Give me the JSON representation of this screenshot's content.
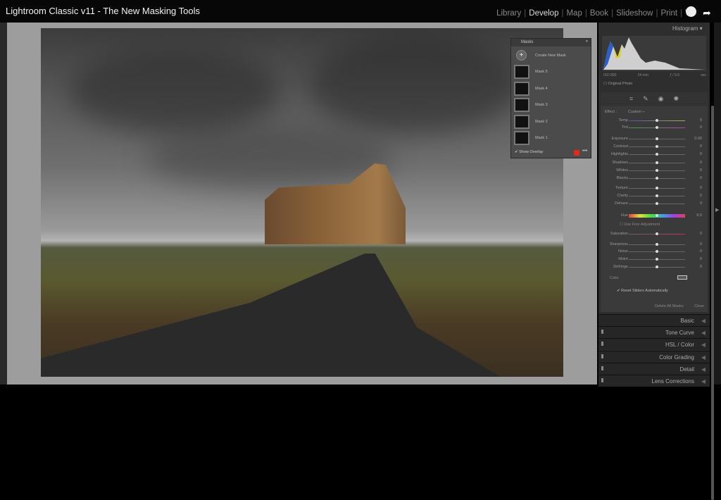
{
  "title": "Lightroom Classic v11 - The New Masking Tools",
  "modules": [
    {
      "label": "Library"
    },
    {
      "label": "Develop",
      "active": true
    },
    {
      "label": "Map"
    },
    {
      "label": "Book"
    },
    {
      "label": "Slideshow"
    },
    {
      "label": "Print"
    },
    {
      "label": "W"
    }
  ],
  "masks_panel": {
    "title": "Masks",
    "create": "Create New Mask",
    "masks": [
      "Mask 5",
      "Mask 4",
      "Mask 3",
      "Mask 2",
      "Mask 1"
    ],
    "show_overlay": "Show Overlay",
    "overlay_color": "#e02a1a"
  },
  "histogram": {
    "title": "Histogram",
    "iso": "ISO 800",
    "focal": "24 mm",
    "aperture": "ƒ / 9.0",
    "shutter": "sec",
    "original_photo": "Original Photo"
  },
  "mask_edit": {
    "effect_label": "Effect :",
    "effect_value": "Custom ÷",
    "sliders": [
      {
        "label": "Temp",
        "value": "0"
      },
      {
        "label": "Tint",
        "value": "0"
      },
      {
        "label": "Exposure",
        "value": "0.00"
      },
      {
        "label": "Contrast",
        "value": "0"
      },
      {
        "label": "Highlights",
        "value": "0"
      },
      {
        "label": "Shadows",
        "value": "0"
      },
      {
        "label": "Whites",
        "value": "0"
      },
      {
        "label": "Blacks",
        "value": "0"
      },
      {
        "label": "Texture",
        "value": "0"
      },
      {
        "label": "Clarity",
        "value": "0"
      },
      {
        "label": "Dehaze",
        "value": "0"
      },
      {
        "label": "Hue",
        "value": "0.0"
      },
      {
        "label": "Saturation",
        "value": "0"
      },
      {
        "label": "Sharpness",
        "value": "0"
      },
      {
        "label": "Noise",
        "value": "0"
      },
      {
        "label": "Moiré",
        "value": "0"
      },
      {
        "label": "Defringe",
        "value": "0"
      }
    ],
    "fine_adjustment": "Use Fine Adjustment",
    "color_label": "Color",
    "reset_sliders": "Reset Sliders Automatically",
    "delete_all": "Delete All Masks",
    "close": "Close"
  },
  "sections": [
    "Basic",
    "Tone Curve",
    "HSL / Color",
    "Color Grading",
    "Detail",
    "Lens Corrections"
  ]
}
